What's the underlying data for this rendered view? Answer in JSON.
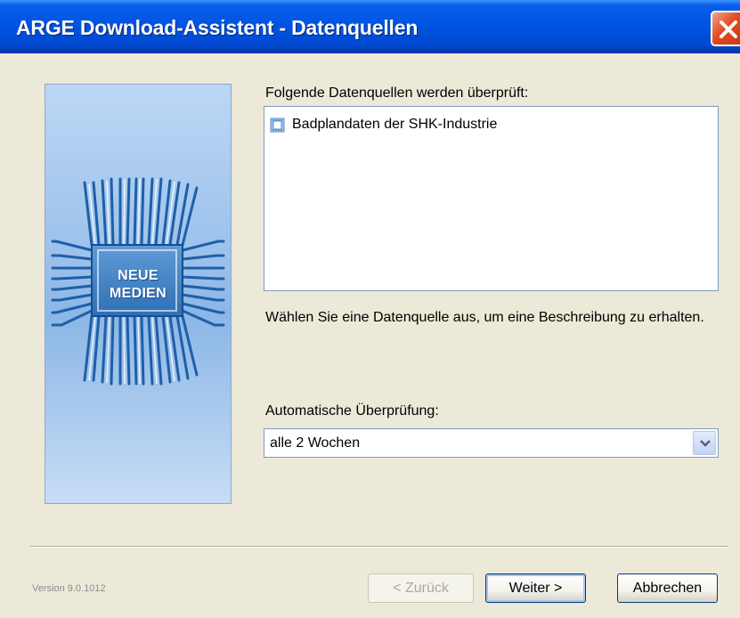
{
  "window": {
    "title": "ARGE Download-Assistent - Datenquellen"
  },
  "logo": {
    "line1": "NEUE",
    "line2": "MEDIEN"
  },
  "sources": {
    "label": "Folgende Datenquellen werden überprüft:",
    "items": [
      {
        "label": "Badplandaten der SHK-Industrie",
        "icon": "database-icon"
      }
    ]
  },
  "description": "Wählen Sie eine Datenquelle aus, um eine Beschreibung zu erhalten.",
  "auto_check": {
    "label": "Automatische Überprüfung:",
    "selected": "alle 2 Wochen"
  },
  "footer": {
    "version": "Version 9.0.1012",
    "back_label": "< Zurück",
    "next_label": "Weiter >",
    "cancel_label": "Abbrechen"
  },
  "colors": {
    "titlebar": "#0054E3",
    "close_button": "#E24A1F",
    "dialog_background": "#ECE9D8",
    "side_panel": "#98BFEA"
  }
}
